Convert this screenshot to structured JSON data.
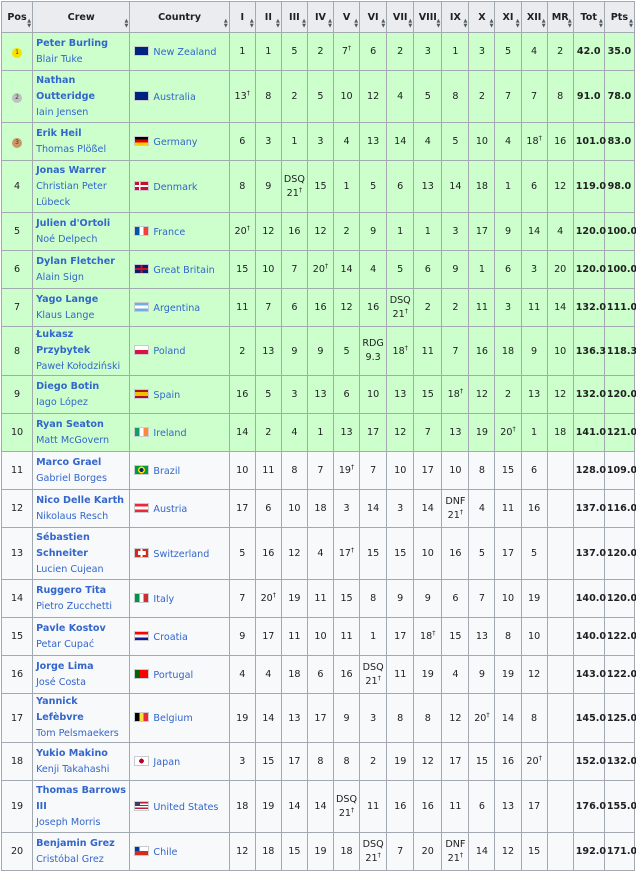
{
  "headers": {
    "pos": "Pos",
    "crew": "Crew",
    "country": "Country",
    "races": [
      "I",
      "II",
      "III",
      "IV",
      "V",
      "VI",
      "VII",
      "VIII",
      "IX",
      "X",
      "XI",
      "XII",
      "MR"
    ],
    "tot": "Tot",
    "pts": "Pts"
  },
  "colors": {
    "medal_row": "#ccffcc",
    "plain_row": "#f8f9fa",
    "link": "#3366cc",
    "gold": "#f7e200",
    "silver": "#c0c0c0",
    "bronze": "#cc9966"
  },
  "rows": [
    {
      "pos": "1",
      "medal": "gold",
      "helm": "Peter Burling",
      "crew": "Blair Tuke",
      "country": "New Zealand",
      "flag": "nz",
      "races": [
        "1",
        "1",
        "5",
        "2",
        "7†",
        "6",
        "2",
        "3",
        "1",
        "3",
        "5",
        "4",
        "2"
      ],
      "tot": "42.0",
      "pts": "35.0",
      "h": 1
    },
    {
      "pos": "2",
      "medal": "silver",
      "helm": "Nathan Outteridge",
      "crew": "Iain Jensen",
      "country": "Australia",
      "flag": "au",
      "races": [
        "13†",
        "8",
        "2",
        "5",
        "10",
        "12",
        "4",
        "5",
        "8",
        "2",
        "7",
        "7",
        "8"
      ],
      "tot": "91.0",
      "pts": "78.0",
      "h": 2
    },
    {
      "pos": "3",
      "medal": "bronze",
      "helm": "Erik Heil",
      "crew": "Thomas Plößel",
      "country": "Germany",
      "flag": "de",
      "races": [
        "6",
        "3",
        "1",
        "3",
        "4",
        "13",
        "14",
        "4",
        "5",
        "10",
        "4",
        "18†",
        "16"
      ],
      "tot": "101.0",
      "pts": "83.0",
      "h": 1
    },
    {
      "pos": "4",
      "medal": "",
      "helm": "Jonas Warrer",
      "crew": "Christian Peter Lübeck",
      "country": "Denmark",
      "flag": "dk",
      "races": [
        "8",
        "9",
        "DSQ 21†",
        "15",
        "1",
        "5",
        "6",
        "13",
        "14",
        "18",
        "1",
        "6",
        "12"
      ],
      "tot": "119.0",
      "pts": "98.0",
      "h": 2
    },
    {
      "pos": "5",
      "medal": "",
      "helm": "Julien d'Ortoli",
      "crew": "Noé Delpech",
      "country": "France",
      "flag": "fr",
      "races": [
        "20†",
        "12",
        "16",
        "12",
        "2",
        "9",
        "1",
        "1",
        "3",
        "17",
        "9",
        "14",
        "4"
      ],
      "tot": "120.0",
      "pts": "100.0",
      "h": 1
    },
    {
      "pos": "6",
      "medal": "",
      "helm": "Dylan Fletcher",
      "crew": "Alain Sign",
      "country": "Great Britain",
      "flag": "gb",
      "races": [
        "15",
        "10",
        "7",
        "20†",
        "14",
        "4",
        "5",
        "6",
        "9",
        "1",
        "6",
        "3",
        "20"
      ],
      "tot": "120.0",
      "pts": "100.0",
      "h": 1
    },
    {
      "pos": "7",
      "medal": "",
      "helm": "Yago Lange",
      "crew": "Klaus Lange",
      "country": "Argentina",
      "flag": "ar",
      "races": [
        "11",
        "7",
        "6",
        "16",
        "12",
        "16",
        "DSQ 21†",
        "2",
        "2",
        "11",
        "3",
        "11",
        "14"
      ],
      "tot": "132.0",
      "pts": "111.0",
      "h": 1
    },
    {
      "pos": "8",
      "medal": "",
      "helm": "Łukasz Przybytek",
      "crew": "Paweł Kołodziński",
      "country": "Poland",
      "flag": "pl",
      "races": [
        "2",
        "13",
        "9",
        "9",
        "5",
        "RDG 9.3",
        "18†",
        "11",
        "7",
        "16",
        "18",
        "9",
        "10"
      ],
      "tot": "136.3",
      "pts": "118.3",
      "h": 1
    },
    {
      "pos": "9",
      "medal": "",
      "helm": "Diego Botin",
      "crew": "Iago López",
      "country": "Spain",
      "flag": "es",
      "races": [
        "16",
        "5",
        "3",
        "13",
        "6",
        "10",
        "13",
        "15",
        "18†",
        "12",
        "2",
        "13",
        "12"
      ],
      "tot": "132.0",
      "pts": "120.0",
      "h": 1
    },
    {
      "pos": "10",
      "medal": "",
      "helm": "Ryan Seaton",
      "crew": "Matt McGovern",
      "country": "Ireland",
      "flag": "ie",
      "races": [
        "14",
        "2",
        "4",
        "1",
        "13",
        "17",
        "12",
        "7",
        "13",
        "19",
        "20†",
        "1",
        "18"
      ],
      "tot": "141.0",
      "pts": "121.0",
      "h": 1
    },
    {
      "pos": "11",
      "medal": "",
      "helm": "Marco Grael",
      "crew": "Gabriel Borges",
      "country": "Brazil",
      "flag": "br",
      "races": [
        "10",
        "11",
        "8",
        "7",
        "19†",
        "7",
        "10",
        "17",
        "10",
        "8",
        "15",
        "6",
        ""
      ],
      "tot": "128.0",
      "pts": "109.0",
      "h": 1
    },
    {
      "pos": "12",
      "medal": "",
      "helm": "Nico Delle Karth",
      "crew": "Nikolaus Resch",
      "country": "Austria",
      "flag": "at",
      "races": [
        "17",
        "6",
        "10",
        "18",
        "3",
        "14",
        "3",
        "14",
        "DNF 21†",
        "4",
        "11",
        "16",
        ""
      ],
      "tot": "137.0",
      "pts": "116.0",
      "h": 1
    },
    {
      "pos": "13",
      "medal": "",
      "helm": "Sébastien Schneiter",
      "crew": "Lucien Cujean",
      "country": "Switzerland",
      "flag": "ch",
      "races": [
        "5",
        "16",
        "12",
        "4",
        "17†",
        "15",
        "15",
        "10",
        "16",
        "5",
        "17",
        "5",
        ""
      ],
      "tot": "137.0",
      "pts": "120.0",
      "h": 2
    },
    {
      "pos": "14",
      "medal": "",
      "helm": "Ruggero Tita",
      "crew": "Pietro Zucchetti",
      "country": "Italy",
      "flag": "it",
      "races": [
        "7",
        "20†",
        "19",
        "11",
        "15",
        "8",
        "9",
        "9",
        "6",
        "7",
        "10",
        "19",
        ""
      ],
      "tot": "140.0",
      "pts": "120.0",
      "h": 1
    },
    {
      "pos": "15",
      "medal": "",
      "helm": "Pavle Kostov",
      "crew": "Petar Cupać",
      "country": "Croatia",
      "flag": "hr",
      "races": [
        "9",
        "17",
        "11",
        "10",
        "11",
        "1",
        "17",
        "18†",
        "15",
        "13",
        "8",
        "10",
        ""
      ],
      "tot": "140.0",
      "pts": "122.0",
      "h": 1
    },
    {
      "pos": "16",
      "medal": "",
      "helm": "Jorge Lima",
      "crew": "José Costa",
      "country": "Portugal",
      "flag": "pt",
      "races": [
        "4",
        "4",
        "18",
        "6",
        "16",
        "DSQ 21†",
        "11",
        "19",
        "4",
        "9",
        "19",
        "12",
        ""
      ],
      "tot": "143.0",
      "pts": "122.0",
      "h": 1
    },
    {
      "pos": "17",
      "medal": "",
      "helm": "Yannick Lefèbvre",
      "crew": "Tom Pelsmaekers",
      "country": "Belgium",
      "flag": "be",
      "races": [
        "19",
        "14",
        "13",
        "17",
        "9",
        "3",
        "8",
        "8",
        "12",
        "20†",
        "14",
        "8",
        ""
      ],
      "tot": "145.0",
      "pts": "125.0",
      "h": 1
    },
    {
      "pos": "18",
      "medal": "",
      "helm": "Yukio Makino",
      "crew": "Kenji Takahashi",
      "country": "Japan",
      "flag": "jp",
      "races": [
        "3",
        "15",
        "17",
        "8",
        "8",
        "2",
        "19",
        "12",
        "17",
        "15",
        "16",
        "20†",
        ""
      ],
      "tot": "152.0",
      "pts": "132.0",
      "h": 1
    },
    {
      "pos": "19",
      "medal": "",
      "helm": "Thomas Barrows III",
      "crew": "Joseph Morris",
      "country": "United States",
      "flag": "us",
      "races": [
        "18",
        "19",
        "14",
        "14",
        "DSQ 21†",
        "11",
        "16",
        "16",
        "11",
        "6",
        "13",
        "17",
        ""
      ],
      "tot": "176.0",
      "pts": "155.0",
      "h": 2
    },
    {
      "pos": "20",
      "medal": "",
      "helm": "Benjamin Grez",
      "crew": "Cristóbal Grez",
      "country": "Chile",
      "flag": "cl",
      "races": [
        "12",
        "18",
        "15",
        "19",
        "18",
        "DSQ 21†",
        "7",
        "20",
        "DNF 21†",
        "14",
        "12",
        "15",
        ""
      ],
      "tot": "192.0",
      "pts": "171.0",
      "h": 1
    }
  ]
}
